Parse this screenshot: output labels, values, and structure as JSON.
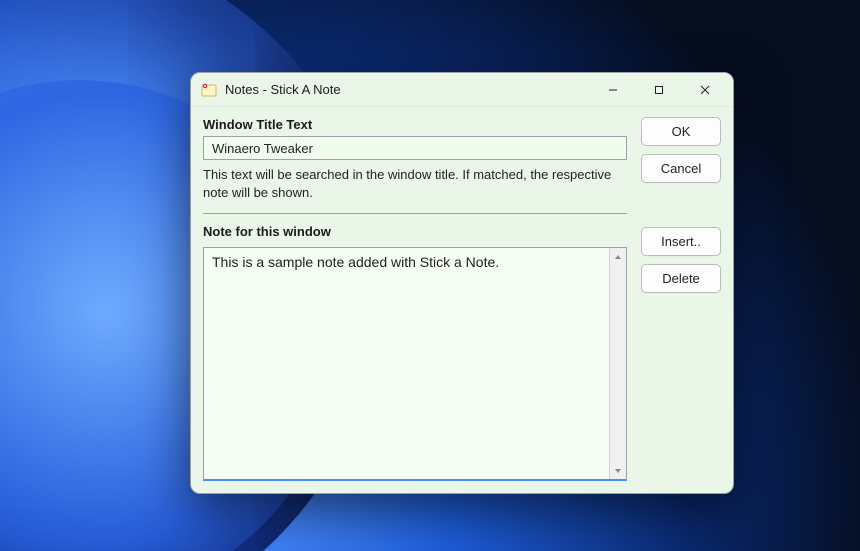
{
  "window": {
    "title": "Notes - Stick A Note"
  },
  "form": {
    "title_label": "Window Title Text",
    "title_value": "Winaero Tweaker",
    "title_help": "This text will be searched in the window title. If matched, the respective note will be shown.",
    "note_label": "Note for this window",
    "note_value": "This is a sample note added with Stick a Note."
  },
  "buttons": {
    "ok": "OK",
    "cancel": "Cancel",
    "insert": "Insert..",
    "delete": "Delete"
  }
}
